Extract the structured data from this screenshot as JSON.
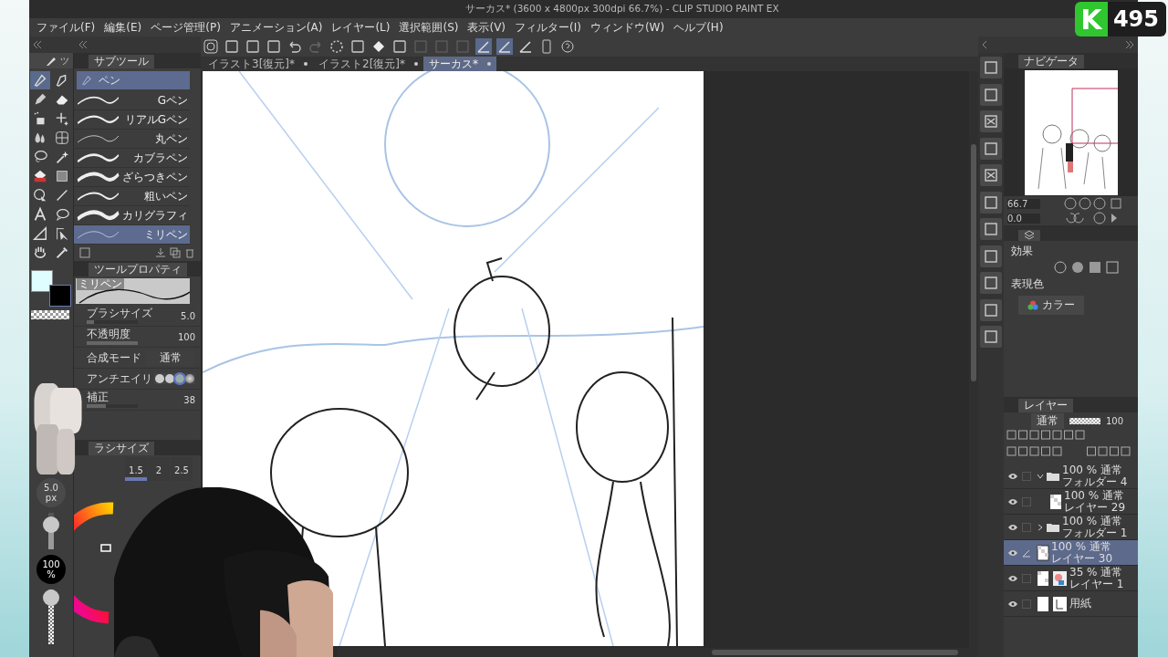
{
  "window": {
    "title": "サーカス* (3600 x 4800px 300dpi 66.7%) - CLIP STUDIO PAINT EX"
  },
  "menu": [
    "ファイル(F)",
    "編集(E)",
    "ページ管理(P)",
    "アニメーション(A)",
    "レイヤー(L)",
    "選択範囲(S)",
    "表示(V)",
    "フィルター(I)",
    "ウィンドウ(W)",
    "ヘルプ(H)"
  ],
  "tabs": [
    {
      "label": "イラスト3[復元]*",
      "selected": false
    },
    {
      "label": "イラスト2[復元]*",
      "selected": false
    },
    {
      "label": "サーカス*",
      "selected": true
    }
  ],
  "tool_palette": {
    "tab_label": "ツ",
    "tools": [
      {
        "selected": true
      },
      {
        "selected": false
      },
      {
        "selected": false
      },
      {
        "selected": false
      },
      {
        "selected": false
      },
      {
        "selected": false
      },
      {
        "selected": false
      },
      {
        "selected": false
      },
      {
        "selected": false
      },
      {
        "selected": false
      },
      {
        "selected": false
      },
      {
        "selected": false
      },
      {
        "selected": false
      },
      {
        "selected": false
      },
      {
        "selected": false
      },
      {
        "selected": false
      },
      {
        "selected": false
      },
      {
        "selected": false
      },
      {
        "selected": false
      },
      {
        "selected": false
      }
    ]
  },
  "sub_tool": {
    "title": "サブツール",
    "group": "ペン",
    "brushes": [
      {
        "name": "Gペン",
        "selected": false
      },
      {
        "name": "リアルGペン",
        "selected": false
      },
      {
        "name": "丸ペン",
        "selected": false
      },
      {
        "name": "カブラペン",
        "selected": false
      },
      {
        "name": "ざらつきペン",
        "selected": false
      },
      {
        "name": "粗いペン",
        "selected": false
      },
      {
        "name": "カリグラフィ",
        "selected": false
      },
      {
        "name": "ミリペン",
        "selected": true
      }
    ]
  },
  "tool_property": {
    "title": "ツールプロパティ",
    "preview_label": "ミリペン",
    "rows": [
      {
        "kind": "number",
        "label": "ブラシサイズ",
        "value": "5.0",
        "level": 0.15
      },
      {
        "kind": "number",
        "label": "不透明度",
        "value": "100",
        "level": 1
      },
      {
        "kind": "dropdown",
        "label": "合成モード",
        "value": "通常"
      },
      {
        "kind": "antialias",
        "label": "アンチエイリ"
      },
      {
        "kind": "number",
        "label": "補正",
        "value": "38",
        "level": 0.38
      }
    ]
  },
  "brush_size": {
    "title": "ラシサイズ",
    "sizes": [
      {
        "label": "1.5",
        "selected": true
      },
      {
        "label": "2",
        "selected": false
      },
      {
        "label": "2.5",
        "selected": false
      }
    ]
  },
  "quick_size": {
    "value": "5.0",
    "unit": "px",
    "level": 0.8
  },
  "quick_opacity": {
    "value": "100",
    "unit": "%",
    "level": 1
  },
  "navigator": {
    "title": "ナビゲータ",
    "zoom": "66.7",
    "angle": "0.0"
  },
  "layer_property": {
    "effect_label": "効果",
    "color_label": "表現色",
    "color_mode": "カラー"
  },
  "layers_panel": {
    "title": "レイヤー",
    "blend": "通常",
    "opacity": "100",
    "opacity_slider": {
      "level": 1
    },
    "layers": [
      {
        "kind": "folder",
        "info": "100 % 通常",
        "name": "フォルダー 4",
        "visible": true,
        "selected": false,
        "expanded": true,
        "children": [
          {
            "kind": "raster",
            "info": "100 % 通常",
            "name": "レイヤー 29",
            "visible": true,
            "selected": false
          }
        ]
      },
      {
        "kind": "folder",
        "info": "100 % 通常",
        "name": "フォルダー 1",
        "visible": true,
        "selected": false,
        "expanded": false
      },
      {
        "kind": "raster",
        "info": "100 % 通常",
        "name": "レイヤー 30",
        "visible": true,
        "selected": true
      },
      {
        "kind": "masked",
        "info": "35 % 通常",
        "name": "レイヤー 1",
        "visible": true,
        "selected": false
      },
      {
        "kind": "paper",
        "name": "用紙",
        "visible": true,
        "selected": false
      }
    ]
  },
  "stream_badge": {
    "letter": "K",
    "count": "495"
  }
}
